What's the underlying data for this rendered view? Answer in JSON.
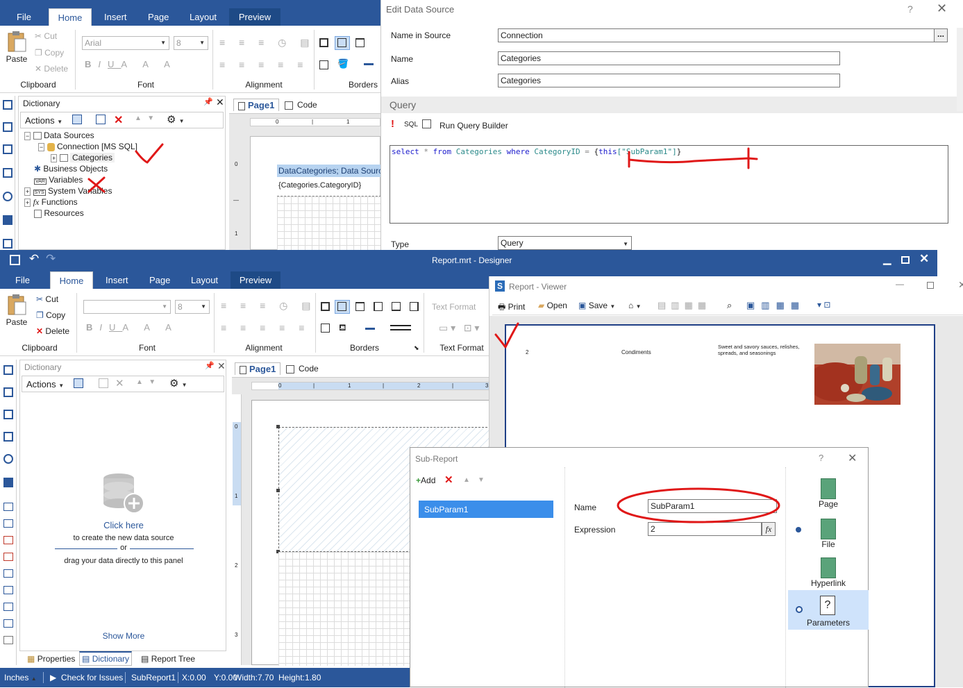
{
  "back": {
    "ribbon_tabs": [
      "File",
      "Home",
      "Insert",
      "Page",
      "Layout",
      "Preview"
    ],
    "clipboard": {
      "paste": "Paste",
      "cut": "Cut",
      "copy": "Copy",
      "delete": "Delete",
      "group": "Clipboard"
    },
    "font": {
      "name": "Arial",
      "size": "8",
      "group": "Font"
    },
    "alignment_group": "Alignment",
    "borders_group": "Borders",
    "dictionary": {
      "title": "Dictionary",
      "actions": "Actions",
      "tree": [
        "Data Sources",
        "Connection [MS SQL]",
        "Categories",
        "Business Objects",
        "Variables",
        "System Variables",
        "Functions",
        "Resources"
      ]
    },
    "tabs": [
      "Page1",
      "Code"
    ],
    "ruler": [
      "0",
      "1"
    ],
    "vruler": [
      "0",
      "1"
    ],
    "band_title": "DataCategories; Data Source",
    "band_field": "{Categories.CategoryID}"
  },
  "edit_ds": {
    "title": "Edit Data Source",
    "help": "?",
    "name_in_source_label": "Name in Source",
    "name_in_source_value": "Connection",
    "browse": "...",
    "name_label": "Name",
    "name_value": "Categories",
    "alias_label": "Alias",
    "alias_value": "Categories",
    "query_header": "Query",
    "sql_label": "SQL",
    "run_query_builder": "Run Query Builder",
    "sql_text": {
      "kw1": "select",
      "star": "*",
      "kw2": "from",
      "table": "Categories",
      "kw3": "where",
      "col": "CategoryID",
      "eq": "=",
      "open": "{",
      "this": "this",
      "param": "[\"SubParam1\"]",
      "close": "}"
    },
    "type_label": "Type",
    "type_value": "Query"
  },
  "designer": {
    "title": "Report.mrt - Designer",
    "ribbon_tabs": [
      "File",
      "Home",
      "Insert",
      "Page",
      "Layout",
      "Preview"
    ],
    "clipboard": {
      "paste": "Paste",
      "cut": "Cut",
      "copy": "Copy",
      "delete": "Delete",
      "group": "Clipboard"
    },
    "font": {
      "size": "8",
      "group": "Font"
    },
    "alignment_group": "Alignment",
    "borders_group": "Borders",
    "text_format_label": "Text Format",
    "text_format_group": "Text Format",
    "dictionary": {
      "title": "Dictionary",
      "actions": "Actions",
      "click_here": "Click here",
      "create_text": "to create the new data source",
      "or": "or",
      "drag_text": "drag your data directly to this panel",
      "show_more": "Show More"
    },
    "bottom_tabs": [
      "Properties",
      "Dictionary",
      "Report Tree"
    ],
    "tabs": [
      "Page1",
      "Code"
    ],
    "ruler": [
      "0",
      "1",
      "2",
      "3"
    ],
    "vruler": [
      "0",
      "1",
      "2",
      "3"
    ],
    "status": {
      "units": "Inches",
      "check": "Check for Issues",
      "component": "SubReport1",
      "x": "X:0.00",
      "y": "Y:0.00",
      "width": "Width:7.70",
      "height": "Height:1.80"
    }
  },
  "viewer": {
    "title": "Report - Viewer",
    "toolbar": {
      "print": "Print",
      "open": "Open",
      "save": "Save"
    },
    "row": {
      "id": "2",
      "name": "Condiments",
      "description": "Sweet and savory sauces, relishes, spreads, and seasonings"
    }
  },
  "subreport": {
    "title": "Sub-Report",
    "help": "?",
    "add": "Add",
    "params": [
      "SubParam1"
    ],
    "name_label": "Name",
    "name_value": "SubParam1",
    "expression_label": "Expression",
    "expression_value": "2",
    "fx": "fx",
    "side": [
      "Page",
      "File",
      "Hyperlink",
      "Parameters"
    ]
  },
  "colors": {
    "ribbon_blue": "#2b579a",
    "selection_blue": "#3b8eea",
    "annotation_red": "#e01818",
    "sql_keyword": "#1a1acc",
    "sql_identifier": "#2b8a8a"
  }
}
